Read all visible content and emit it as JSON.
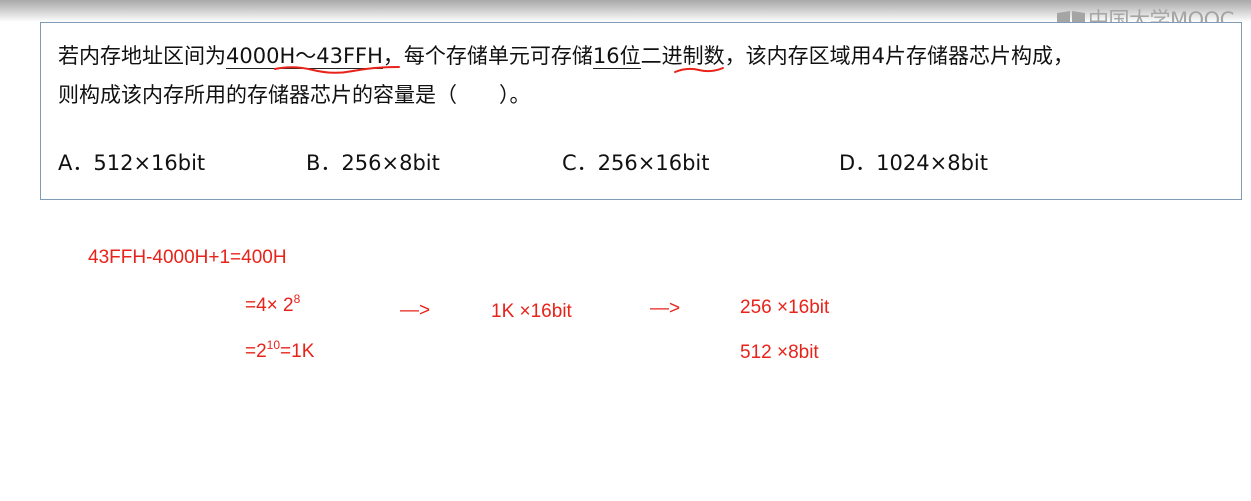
{
  "brand": {
    "logo_text": "中国大学MOOC",
    "logo_icon": "book-icon"
  },
  "question": {
    "line1_part1": "若内存地址区间为",
    "line1_range": "4000H～43FFH",
    "line1_part2": "，每个存储单元可存储",
    "line1_bits": "16位",
    "line1_part3": "二进制数，该内存区域用4片存储器芯片构成，",
    "line2": "则构成该内存所用的存储器芯片的容量是（　　）。",
    "options": [
      "A．512×16bit",
      "B．256×8bit",
      "C．256×16bit",
      "D．1024×8bit"
    ]
  },
  "notes": {
    "calc_line": "43FFH-4000H+1=400H",
    "step1_prefix": "=4× 2",
    "step1_exp": "8",
    "step2_prefix": "=2",
    "step2_exp": "10",
    "step2_suffix": "=1K",
    "arrow1": "—>",
    "mid_result": "1K ×16bit",
    "arrow2": "—>",
    "result1": "256 ×16bit",
    "result2": "512 ×8bit"
  },
  "colors": {
    "ink": "#111111",
    "annotation_red": "#e8231a",
    "box_border": "#7f9bb5",
    "logo_gray": "#a5a5a5"
  }
}
